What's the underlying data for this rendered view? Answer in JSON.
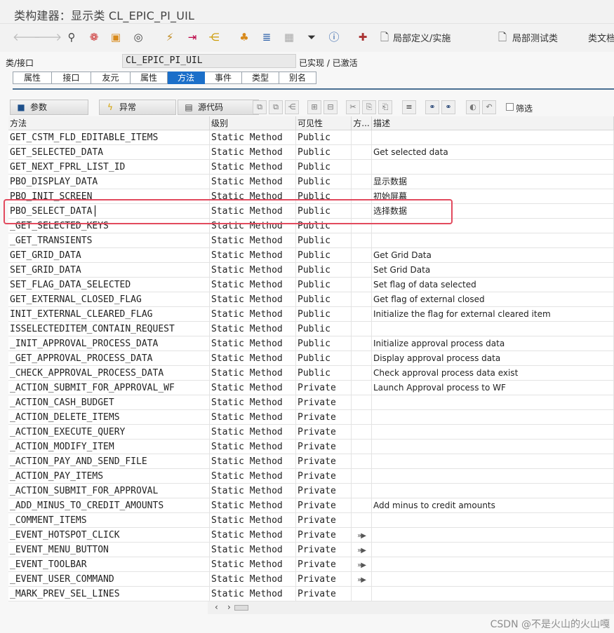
{
  "window": {
    "title": "类构建器：显示类 CL_EPIC_PI_UIL"
  },
  "toolbar": {
    "local_definitions_label": "局部定义/实施",
    "local_test_classes_label": "局部测试类",
    "class_doc_label": "类文档"
  },
  "header": {
    "class_label": "类/接口",
    "class_name": "CL_EPIC_PI_UIL",
    "status": "已实现 / 已激活"
  },
  "tabs": [
    {
      "label": "属性"
    },
    {
      "label": "接口"
    },
    {
      "label": "友元"
    },
    {
      "label": "属性"
    },
    {
      "label": "方法",
      "active": true
    },
    {
      "label": "事件"
    },
    {
      "label": "类型"
    },
    {
      "label": "别名"
    }
  ],
  "method_toolbar": {
    "parameters_label": "参数",
    "exceptions_label": "异常",
    "source_code_label": "源代码",
    "filter_label": "筛选"
  },
  "grid": {
    "columns": [
      "方法",
      "级别",
      "可见性",
      "方...",
      "描述"
    ],
    "rows": [
      {
        "method": "GET_CSTM_FLD_EDITABLE_ITEMS",
        "level": "Static Method",
        "visibility": "Public",
        "flag": "",
        "description": ""
      },
      {
        "method": "GET_SELECTED_DATA",
        "level": "Static Method",
        "visibility": "Public",
        "flag": "",
        "description": "Get selected data"
      },
      {
        "method": "GET_NEXT_FPRL_LIST_ID",
        "level": "Static Method",
        "visibility": "Public",
        "flag": "",
        "description": ""
      },
      {
        "method": "PBO_DISPLAY_DATA",
        "level": "Static Method",
        "visibility": "Public",
        "flag": "",
        "description": "显示数据"
      },
      {
        "method": "PBO_INIT_SCREEN",
        "level": "Static Method",
        "visibility": "Public",
        "flag": "",
        "description": "初始屏幕"
      },
      {
        "method": "PBO_SELECT_DATA",
        "level": "Static Method",
        "visibility": "Public",
        "flag": "",
        "description": "选择数据"
      },
      {
        "method": "_GET_SELECTED_KEYS",
        "level": "Static Method",
        "visibility": "Public",
        "flag": "",
        "description": ""
      },
      {
        "method": "_GET_TRANSIENTS",
        "level": "Static Method",
        "visibility": "Public",
        "flag": "",
        "description": ""
      },
      {
        "method": "GET_GRID_DATA",
        "level": "Static Method",
        "visibility": "Public",
        "flag": "",
        "description": "Get Grid Data"
      },
      {
        "method": "SET_GRID_DATA",
        "level": "Static Method",
        "visibility": "Public",
        "flag": "",
        "description": "Set Grid Data"
      },
      {
        "method": "SET_FLAG_DATA_SELECTED",
        "level": "Static Method",
        "visibility": "Public",
        "flag": "",
        "description": "Set flag of data selected"
      },
      {
        "method": "GET_EXTERNAL_CLOSED_FLAG",
        "level": "Static Method",
        "visibility": "Public",
        "flag": "",
        "description": "Get flag of external closed"
      },
      {
        "method": "INIT_EXTERNAL_CLEARED_FLAG",
        "level": "Static Method",
        "visibility": "Public",
        "flag": "",
        "description": "Initialize the flag for external cleared item"
      },
      {
        "method": "ISSELECTEDITEM_CONTAIN_REQUEST",
        "level": "Static Method",
        "visibility": "Public",
        "flag": "",
        "description": ""
      },
      {
        "method": "_INIT_APPROVAL_PROCESS_DATA",
        "level": "Static Method",
        "visibility": "Public",
        "flag": "",
        "description": "Initialize approval process data"
      },
      {
        "method": "_GET_APPROVAL_PROCESS_DATA",
        "level": "Static Method",
        "visibility": "Public",
        "flag": "",
        "description": "Display approval process data"
      },
      {
        "method": "_CHECK_APPROVAL_PROCESS_DATA",
        "level": "Static Method",
        "visibility": "Public",
        "flag": "",
        "description": "Check approval process data exist"
      },
      {
        "method": "_ACTION_SUBMIT_FOR_APPROVAL_WF",
        "level": "Static Method",
        "visibility": "Private",
        "flag": "",
        "description": "Launch Approval process to WF"
      },
      {
        "method": "_ACTION_CASH_BUDGET",
        "level": "Static Method",
        "visibility": "Private",
        "flag": "",
        "description": ""
      },
      {
        "method": "_ACTION_DELETE_ITEMS",
        "level": "Static Method",
        "visibility": "Private",
        "flag": "",
        "description": ""
      },
      {
        "method": "_ACTION_EXECUTE_QUERY",
        "level": "Static Method",
        "visibility": "Private",
        "flag": "",
        "description": ""
      },
      {
        "method": "_ACTION_MODIFY_ITEM",
        "level": "Static Method",
        "visibility": "Private",
        "flag": "",
        "description": ""
      },
      {
        "method": "_ACTION_PAY_AND_SEND_FILE",
        "level": "Static Method",
        "visibility": "Private",
        "flag": "",
        "description": ""
      },
      {
        "method": "_ACTION_PAY_ITEMS",
        "level": "Static Method",
        "visibility": "Private",
        "flag": "",
        "description": ""
      },
      {
        "method": "_ACTION_SUBMIT_FOR_APPROVAL",
        "level": "Static Method",
        "visibility": "Private",
        "flag": "",
        "description": ""
      },
      {
        "method": "_ADD_MINUS_TO_CREDIT_AMOUNTS",
        "level": "Static Method",
        "visibility": "Private",
        "flag": "",
        "description": "Add minus to credit amounts"
      },
      {
        "method": "_COMMENT_ITEMS",
        "level": "Static Method",
        "visibility": "Private",
        "flag": "",
        "description": ""
      },
      {
        "method": "_EVENT_HOTSPOT_CLICK",
        "level": "Static Method",
        "visibility": "Private",
        "flag": "event-handler-icon",
        "description": ""
      },
      {
        "method": "_EVENT_MENU_BUTTON",
        "level": "Static Method",
        "visibility": "Private",
        "flag": "event-handler-icon",
        "description": ""
      },
      {
        "method": "_EVENT_TOOLBAR",
        "level": "Static Method",
        "visibility": "Private",
        "flag": "event-handler-icon",
        "description": ""
      },
      {
        "method": "_EVENT_USER_COMMAND",
        "level": "Static Method",
        "visibility": "Private",
        "flag": "event-handler-icon",
        "description": ""
      },
      {
        "method": "_MARK_PREV_SEL_LINES",
        "level": "Static Method",
        "visibility": "Private",
        "flag": "",
        "description": ""
      }
    ]
  },
  "colors": {
    "active_tab": "#1b6fc9",
    "highlight_box": "#e24a5e"
  },
  "watermark": "CSDN @不是火山的火山嘎"
}
